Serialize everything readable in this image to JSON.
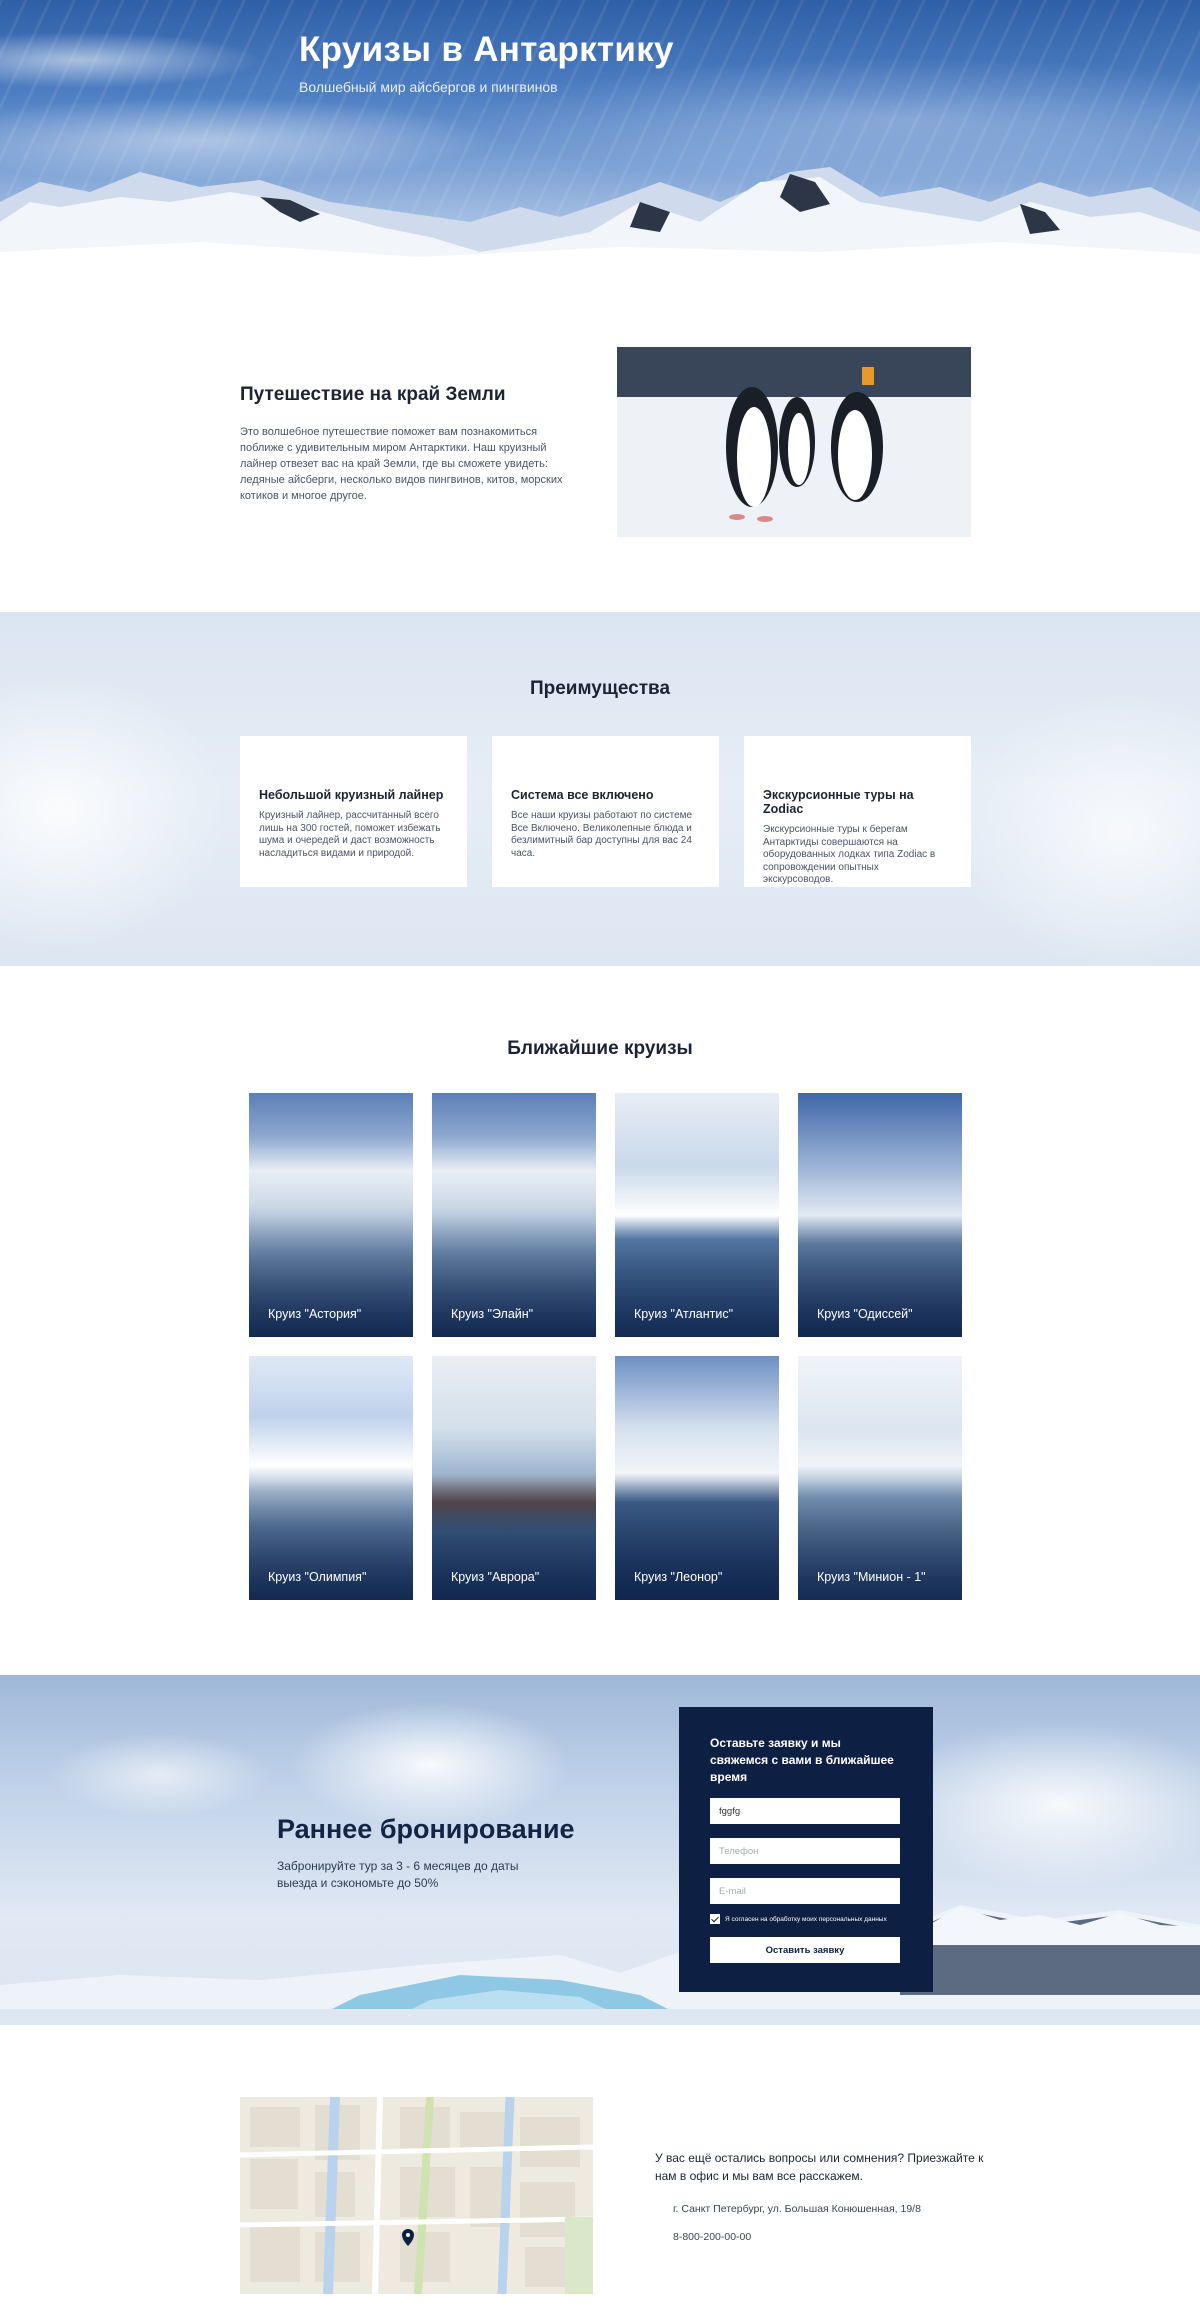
{
  "hero": {
    "title": "Круизы в Антарктику",
    "subtitle": "Волшебный мир айсбергов и пингвинов"
  },
  "intro": {
    "title": "Путешествие на край Земли",
    "text": "Это волшебное путешествие поможет вам познакомиться поближе с удивительным миром Антарктики. Наш круизный лайнер отвезет вас на край Земли, где вы сможете увидеть: ледяные айсберги, несколько видов пингвинов, китов, морских котиков и многое другое."
  },
  "advantages": {
    "title": "Преимущества",
    "cards": [
      {
        "title": "Небольшой круизный лайнер",
        "text": "Круизный лайнер, рассчитанный всего лишь на 300 гостей, поможет избежать шума и очередей и даст возможность насладиться видами и природой."
      },
      {
        "title": "Система все включено",
        "text": "Все наши круизы работают по системе Все Включено. Великолепные блюда и безлимитный бар доступны для вас 24 часа."
      },
      {
        "title": "Экскурсионные туры на Zodiac",
        "text": "Экскурсионные туры к берегам Антарктиды совершаются на оборудованных лодках типа Zodiac в сопровождении опытных экскурсоводов."
      }
    ]
  },
  "cruises": {
    "title": "Ближайшие круизы",
    "items": [
      {
        "label": "Круиз \"Астория\""
      },
      {
        "label": "Круиз \"Элайн\""
      },
      {
        "label": "Круиз \"Атлантис\""
      },
      {
        "label": "Круиз \"Одиссей\""
      },
      {
        "label": "Круиз \"Олимпия\""
      },
      {
        "label": "Круиз \"Аврора\""
      },
      {
        "label": "Круиз \"Леонор\""
      },
      {
        "label": "Круиз \"Минион - 1\""
      }
    ]
  },
  "booking": {
    "title": "Раннее бронирование",
    "text": "Забронируйте тур за 3 - 6 месяцев до даты выезда и сэкономьте до 50%",
    "form_title": "Оставьте заявку и мы свяжемся с вами в ближайшее время",
    "name_value": "fggfg",
    "phone_placeholder": "Телефон",
    "email_placeholder": "E-mail",
    "agree_text": "Я согласен на обработку моих персональных данных",
    "agree_checked": true,
    "submit_label": "Оставить заявку",
    "accent_color": "#0e1f44"
  },
  "contacts": {
    "question": "У вас ещё остались вопросы или сомнения? Приезжайте к нам в офис и мы вам все расскажем.",
    "address": "г. Санкт Петербург, ул. Большая Конюшенная, 19/8",
    "phone": "8-800-200-00-00"
  }
}
